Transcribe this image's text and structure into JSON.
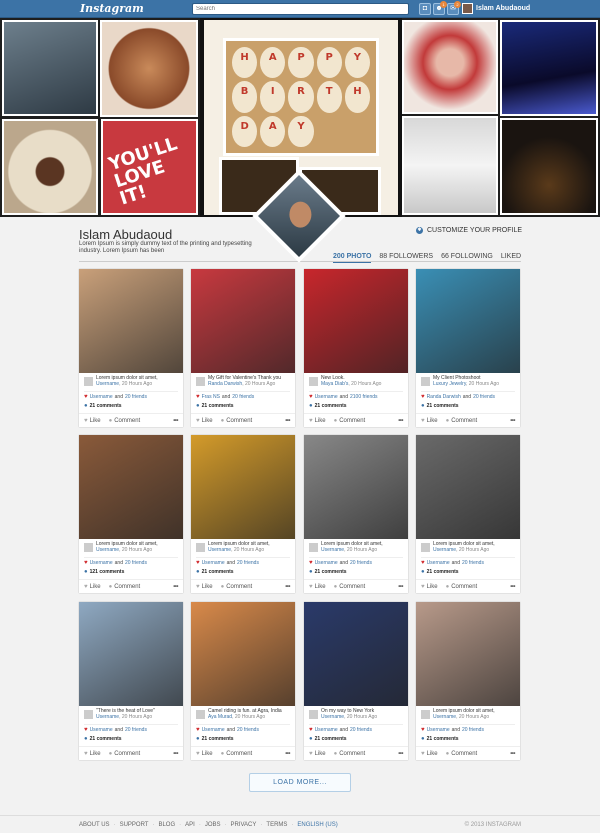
{
  "header": {
    "logo": "Instagram",
    "search_placeholder": "Search",
    "notif_badge_1": "1",
    "notif_badge_2": "2",
    "username": "Islam Abudaoud"
  },
  "banner": {
    "cupcake_letters": [
      "H",
      "A",
      "P",
      "P",
      "Y",
      "B",
      "I",
      "R",
      "T",
      "H",
      "D",
      "A",
      "Y"
    ],
    "love_text_line1": "YOU'LL",
    "love_text_line2": "LOVE IT!"
  },
  "profile": {
    "name": "Islam Abudaoud",
    "bio": "Lorem Ipsum is simply dummy text of the printing and typesetting industry. Lorem Ipsum has been",
    "customize_label": "CUSTOMIZE YOUR PROFILE",
    "stats": [
      {
        "label": "200 PHOTO"
      },
      {
        "label": "88 FOLLOWERS"
      },
      {
        "label": "66 FOLLOWING"
      },
      {
        "label": "LIKED"
      }
    ]
  },
  "colors": {
    "accent": "#3c73a6",
    "heart": "#d0282c",
    "topbar": "#3c73a6"
  },
  "card_common": {
    "like": "Like",
    "comment": "Comment",
    "more": "•••"
  },
  "cards": [
    {
      "caption": "Lorem ipsum dolor sit amet,",
      "user": "Username",
      "time": "20 Hours Ago",
      "likes_a": "Username",
      "likes_b": "20 friends",
      "comments": "21 comments",
      "color": "#c9a07a"
    },
    {
      "caption": "My Gift for Valentine's Thank you",
      "user": "Randa Darwish",
      "time": "20 Hours Ago",
      "likes_a": "Fras NS",
      "likes_b": "20 friends",
      "comments": "21 comments",
      "color": "#c8393f"
    },
    {
      "caption": "New Look.",
      "user": "Maya Diab's",
      "time": "20 Hours Ago",
      "likes_a": "Username",
      "likes_b": "2100 friends",
      "comments": "21 comments",
      "color": "#c8262c"
    },
    {
      "caption": "My Client Photoshoot",
      "user": "Luxury Jewelry",
      "time": "20 Hours Ago",
      "likes_a": "Randa Darwish",
      "likes_b": "20 friends",
      "comments": "21 comments",
      "color": "#3a8fb5"
    },
    {
      "caption": "Lorem ipsum dolor sit amet,",
      "user": "Username",
      "time": "20 Hours Ago",
      "likes_a": "Username",
      "likes_b": "20 friends",
      "comments": "121 comments",
      "color": "#8a5a3a"
    },
    {
      "caption": "Lorem ipsum dolor sit amet,",
      "user": "Username",
      "time": "20 Hours Ago",
      "likes_a": "Username",
      "likes_b": "20 friends",
      "comments": "21 comments",
      "color": "#d49b2a"
    },
    {
      "caption": "Lorem ipsum dolor sit amet,",
      "user": "Username",
      "time": "20 Hours Ago",
      "likes_a": "Username",
      "likes_b": "20 friends",
      "comments": "21 comments",
      "color": "#888888"
    },
    {
      "caption": "Lorem ipsum dolor sit amet,",
      "user": "Username",
      "time": "20 Hours Ago",
      "likes_a": "Username",
      "likes_b": "20 friends",
      "comments": "21 comments",
      "color": "#6a6a6a"
    },
    {
      "caption": "\"There is the heat of Love\"",
      "user": "Username",
      "time": "20 Hours Ago",
      "likes_a": "Username",
      "likes_b": "20 friends",
      "comments": "21 comments",
      "color": "#8fa9c2"
    },
    {
      "caption": "Camel riding is fun. at Agra, India",
      "user": "Aya Murad",
      "time": "20 Hours Ago",
      "likes_a": "Username",
      "likes_b": "20 friends",
      "comments": "21 comments",
      "color": "#d98a4a"
    },
    {
      "caption": "On my way to New York",
      "user": "Username",
      "time": "20 Hours Ago",
      "likes_a": "Username",
      "likes_b": "20 friends",
      "comments": "21 comments",
      "color": "#2a3a6a"
    },
    {
      "caption": "Lorem ipsum dolor sit amet,",
      "user": "Username",
      "time": "20 Hours Ago",
      "likes_a": "Username",
      "likes_b": "20 friends",
      "comments": "21 comments",
      "color": "#b89a8a"
    }
  ],
  "load_more": "LOAD MORE...",
  "footer": {
    "links": [
      "ABOUT US",
      "SUPPORT",
      "BLOG",
      "API",
      "JOBS",
      "PRIVACY",
      "TERMS",
      "ENGLISH (US)"
    ],
    "copyright": "© 2013 INSTAGRAM"
  }
}
